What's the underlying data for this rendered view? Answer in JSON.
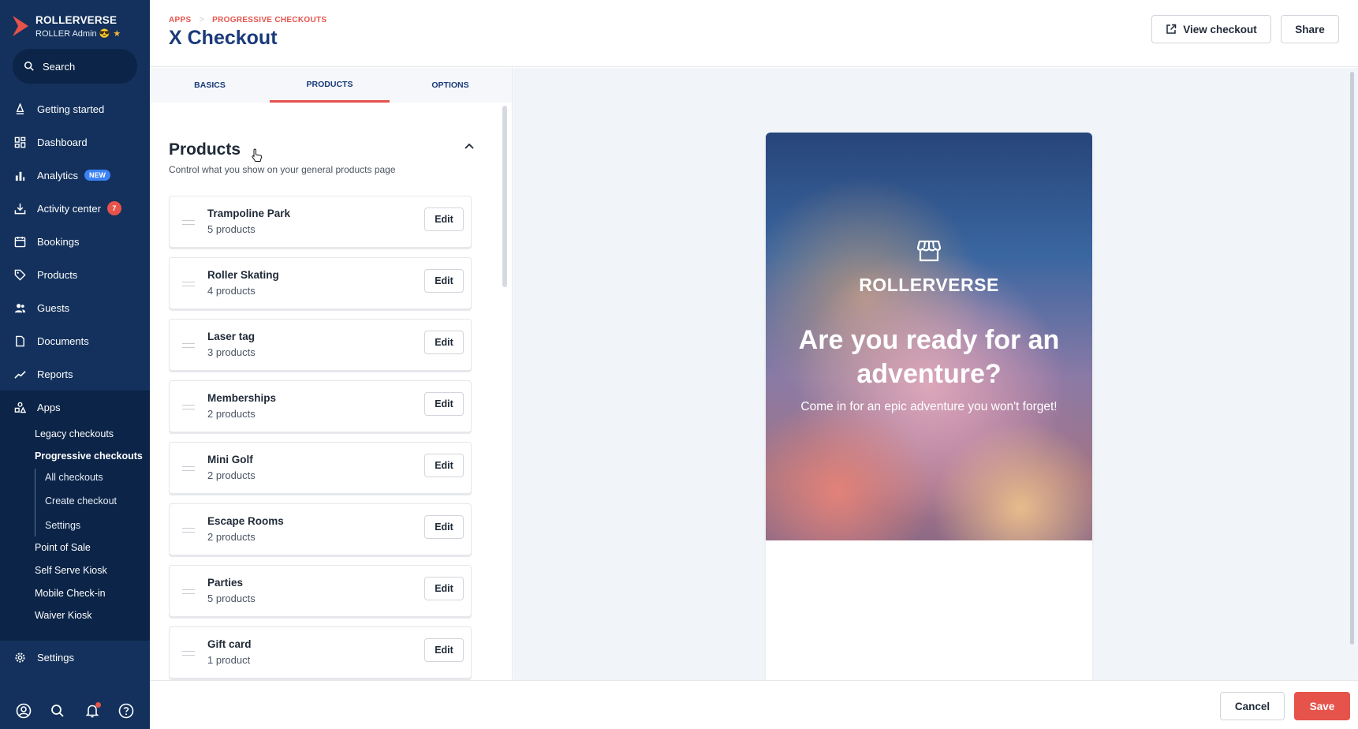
{
  "sidebar": {
    "brand": "ROLLERVERSE",
    "role": "ROLLER Admin 😎",
    "search_label": "Search",
    "nav": [
      {
        "label": "Getting started",
        "icon": "rocket-icon"
      },
      {
        "label": "Dashboard",
        "icon": "dashboard-icon"
      },
      {
        "label": "Analytics",
        "icon": "bar-chart-icon",
        "badge": "NEW"
      },
      {
        "label": "Activity center",
        "icon": "download-tray-icon",
        "badge": "7"
      },
      {
        "label": "Bookings",
        "icon": "calendar-icon"
      },
      {
        "label": "Products",
        "icon": "tag-icon"
      },
      {
        "label": "Guests",
        "icon": "users-icon"
      },
      {
        "label": "Documents",
        "icon": "document-icon"
      },
      {
        "label": "Reports",
        "icon": "trend-line-icon"
      },
      {
        "label": "Apps",
        "icon": "apps-icon"
      }
    ],
    "apps_sub": [
      "Legacy checkouts",
      "Progressive checkouts",
      "Point of Sale",
      "Self Serve Kiosk",
      "Mobile Check-in",
      "Waiver Kiosk"
    ],
    "progressive_sub": [
      "All checkouts",
      "Create checkout",
      "Settings"
    ],
    "settings_label": "Settings",
    "bottom_icons": [
      "profile-icon",
      "search-icon",
      "bell-icon",
      "help-icon"
    ]
  },
  "header": {
    "breadcrumb": [
      "APPS",
      "PROGRESSIVE CHECKOUTS"
    ],
    "title": "X Checkout",
    "view_checkout": "View checkout",
    "share": "Share"
  },
  "tabs": [
    "BASICS",
    "PRODUCTS",
    "OPTIONS"
  ],
  "active_tab": "PRODUCTS",
  "section": {
    "title": "Products",
    "subtitle": "Control what you show on your general products page"
  },
  "categories": [
    {
      "name": "Trampoline Park",
      "count": "5 products",
      "edit": "Edit"
    },
    {
      "name": "Roller Skating",
      "count": "4 products",
      "edit": "Edit"
    },
    {
      "name": "Laser tag",
      "count": "3 products",
      "edit": "Edit"
    },
    {
      "name": "Memberships",
      "count": "2 products",
      "edit": "Edit"
    },
    {
      "name": "Mini Golf",
      "count": "2 products",
      "edit": "Edit"
    },
    {
      "name": "Escape Rooms",
      "count": "2 products",
      "edit": "Edit"
    },
    {
      "name": "Parties",
      "count": "5 products",
      "edit": "Edit"
    },
    {
      "name": "Gift card",
      "count": "1 product",
      "edit": "Edit"
    }
  ],
  "preview": {
    "brand": "ROLLERVERSE",
    "headline": "Are you ready for an adventure?",
    "subline": "Come in for an epic adventure you won't forget!"
  },
  "footer": {
    "cancel": "Cancel",
    "save": "Save"
  },
  "colors": {
    "sidebar": "#13315c",
    "sidebar_dark": "#0b2447",
    "accent": "#e5534b",
    "title": "#1a3a7a"
  }
}
